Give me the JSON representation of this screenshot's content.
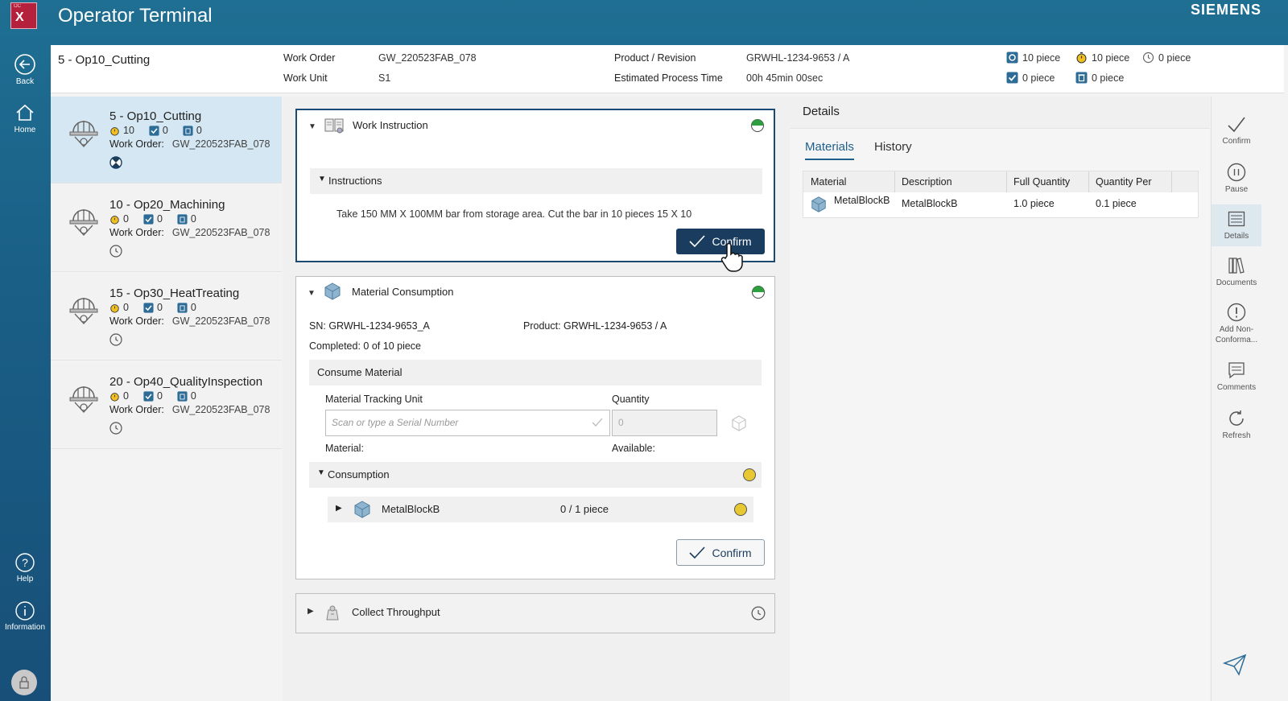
{
  "app": {
    "logo_small": "OC",
    "logo_letter": "X",
    "title": "Operator Terminal",
    "brand": "SIEMENS"
  },
  "left_nav": {
    "back": "Back",
    "home": "Home",
    "help": "Help",
    "information": "Information"
  },
  "header": {
    "operation": "5 - Op10_Cutting",
    "work_order_label": "Work Order",
    "work_order": "GW_220523FAB_078",
    "work_unit_label": "Work Unit",
    "work_unit": "S1",
    "product_label": "Product / Revision",
    "product": "GRWHL-1234-9653 / A",
    "ept_label": "Estimated Process Time",
    "ept": "00h 45min 00sec",
    "counters": [
      "10 piece",
      "10 piece",
      "0 piece",
      "0 piece",
      "0 piece"
    ]
  },
  "operations": [
    {
      "name": "5 - Op10_Cutting",
      "c1": "10",
      "c2": "0",
      "c3": "0",
      "wo_label": "Work Order:",
      "wo": "GW_220523FAB_078"
    },
    {
      "name": "10 - Op20_Machining",
      "c1": "0",
      "c2": "0",
      "c3": "0",
      "wo_label": "Work Order:",
      "wo": "GW_220523FAB_078"
    },
    {
      "name": "15 - Op30_HeatTreating",
      "c1": "0",
      "c2": "0",
      "c3": "0",
      "wo_label": "Work Order:",
      "wo": "GW_220523FAB_078"
    },
    {
      "name": "20 - Op40_QualityInspection",
      "c1": "0",
      "c2": "0",
      "c3": "0",
      "wo_label": "Work Order:",
      "wo": "GW_220523FAB_078"
    }
  ],
  "work_instruction": {
    "title": "Work Instruction",
    "instructions_label": "Instructions",
    "text": "Take 150 MM X 100MM bar from storage area. Cut the bar in 10 pieces 15 X 10",
    "confirm": "Confirm"
  },
  "material_consumption": {
    "title": "Material Consumption",
    "sn_label": "SN:",
    "sn": "GRWHL-1234-9653_A",
    "product_label": "Product:",
    "product": "GRWHL-1234-9653 / A",
    "completed_label": "Completed:",
    "completed": "0 of 10 piece",
    "consume_label": "Consume Material",
    "mtu_label": "Material Tracking Unit",
    "mtu_placeholder": "Scan or type a Serial Number",
    "qty_label": "Quantity",
    "qty_value": "0",
    "material_label": "Material:",
    "available_label": "Available:",
    "consumption_label": "Consumption",
    "item_name": "MetalBlockB",
    "item_qty": "0 / 1 piece",
    "confirm": "Confirm"
  },
  "collect_throughput": {
    "title": "Collect Throughput"
  },
  "details": {
    "title": "Details",
    "tabs": [
      "Materials",
      "History"
    ],
    "columns": [
      "Material",
      "Description",
      "Full Quantity",
      "Quantity Per"
    ],
    "rows": [
      {
        "material": "MetalBlockB",
        "description": "MetalBlockB",
        "full_qty": "1.0 piece",
        "qty_per": "0.1 piece"
      }
    ]
  },
  "right_nav": {
    "confirm": "Confirm",
    "pause": "Pause",
    "details": "Details",
    "documents": "Documents",
    "add_nc_1": "Add Non-",
    "add_nc_2": "Conforma...",
    "comments": "Comments",
    "refresh": "Refresh"
  },
  "colors": {
    "accent": "#1f5f8b",
    "primary_button": "#1a3c5e",
    "status_green": "#2e9e3e",
    "status_yellow": "#e8c832",
    "logo": "#b5213c"
  }
}
